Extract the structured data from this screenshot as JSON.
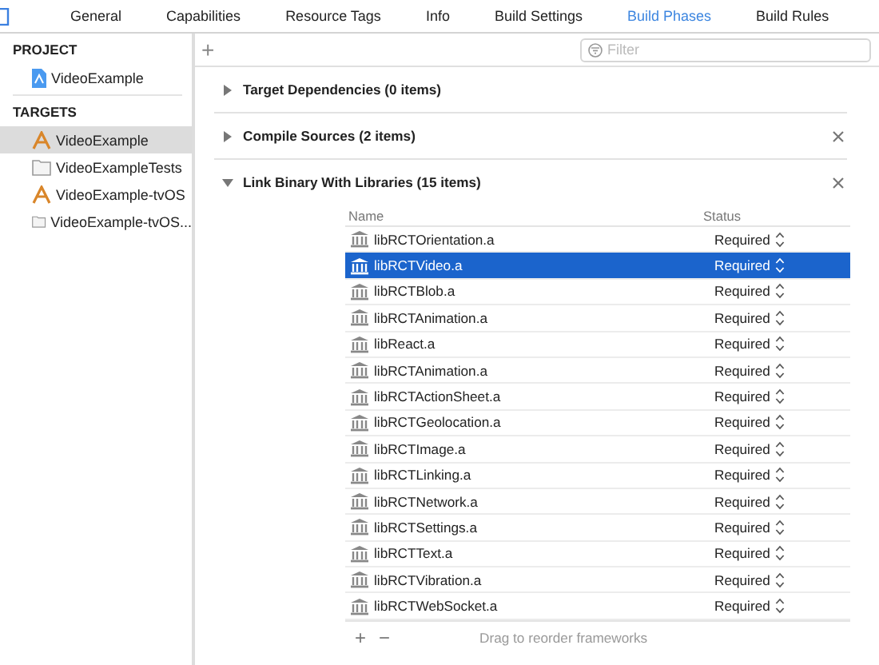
{
  "tabs": [
    {
      "label": "General",
      "selected": false
    },
    {
      "label": "Capabilities",
      "selected": false
    },
    {
      "label": "Resource Tags",
      "selected": false
    },
    {
      "label": "Info",
      "selected": false
    },
    {
      "label": "Build Settings",
      "selected": false
    },
    {
      "label": "Build Phases",
      "selected": true
    },
    {
      "label": "Build Rules",
      "selected": false
    }
  ],
  "sidebar": {
    "groups": [
      {
        "title": "PROJECT",
        "items": [
          {
            "label": "VideoExample",
            "kind": "project",
            "selected": false
          }
        ]
      },
      {
        "title": "TARGETS",
        "items": [
          {
            "label": "VideoExample",
            "kind": "app",
            "selected": true
          },
          {
            "label": "VideoExampleTests",
            "kind": "test",
            "selected": false
          },
          {
            "label": "VideoExample-tvOS",
            "kind": "app",
            "selected": false
          },
          {
            "label": "VideoExample-tvOS...",
            "kind": "test",
            "selected": false
          }
        ]
      }
    ]
  },
  "toolbar": {
    "add": "+",
    "filter": {
      "placeholder": "Filter"
    }
  },
  "phases": [
    {
      "title": "Target Dependencies (0 items)",
      "expanded": false,
      "removable": false
    },
    {
      "title": "Compile Sources (2 items)",
      "expanded": false,
      "removable": true
    },
    {
      "title": "Link Binary With Libraries (15 items)",
      "expanded": true,
      "removable": true
    }
  ],
  "table": {
    "columns": [
      "Name",
      "Status"
    ],
    "rows": [
      {
        "name": "libRCTOrientation.a",
        "status": "Required",
        "selected": false
      },
      {
        "name": "libRCTVideo.a",
        "status": "Required",
        "selected": true
      },
      {
        "name": "libRCTBlob.a",
        "status": "Required",
        "selected": false
      },
      {
        "name": "libRCTAnimation.a",
        "status": "Required",
        "selected": false
      },
      {
        "name": "libReact.a",
        "status": "Required",
        "selected": false
      },
      {
        "name": "libRCTAnimation.a",
        "status": "Required",
        "selected": false
      },
      {
        "name": "libRCTActionSheet.a",
        "status": "Required",
        "selected": false
      },
      {
        "name": "libRCTGeolocation.a",
        "status": "Required",
        "selected": false
      },
      {
        "name": "libRCTImage.a",
        "status": "Required",
        "selected": false
      },
      {
        "name": "libRCTLinking.a",
        "status": "Required",
        "selected": false
      },
      {
        "name": "libRCTNetwork.a",
        "status": "Required",
        "selected": false
      },
      {
        "name": "libRCTSettings.a",
        "status": "Required",
        "selected": false
      },
      {
        "name": "libRCTText.a",
        "status": "Required",
        "selected": false
      },
      {
        "name": "libRCTVibration.a",
        "status": "Required",
        "selected": false
      },
      {
        "name": "libRCTWebSocket.a",
        "status": "Required",
        "selected": false
      }
    ],
    "footer": {
      "add": "+",
      "remove": "−",
      "hint": "Drag to reorder frameworks"
    }
  }
}
